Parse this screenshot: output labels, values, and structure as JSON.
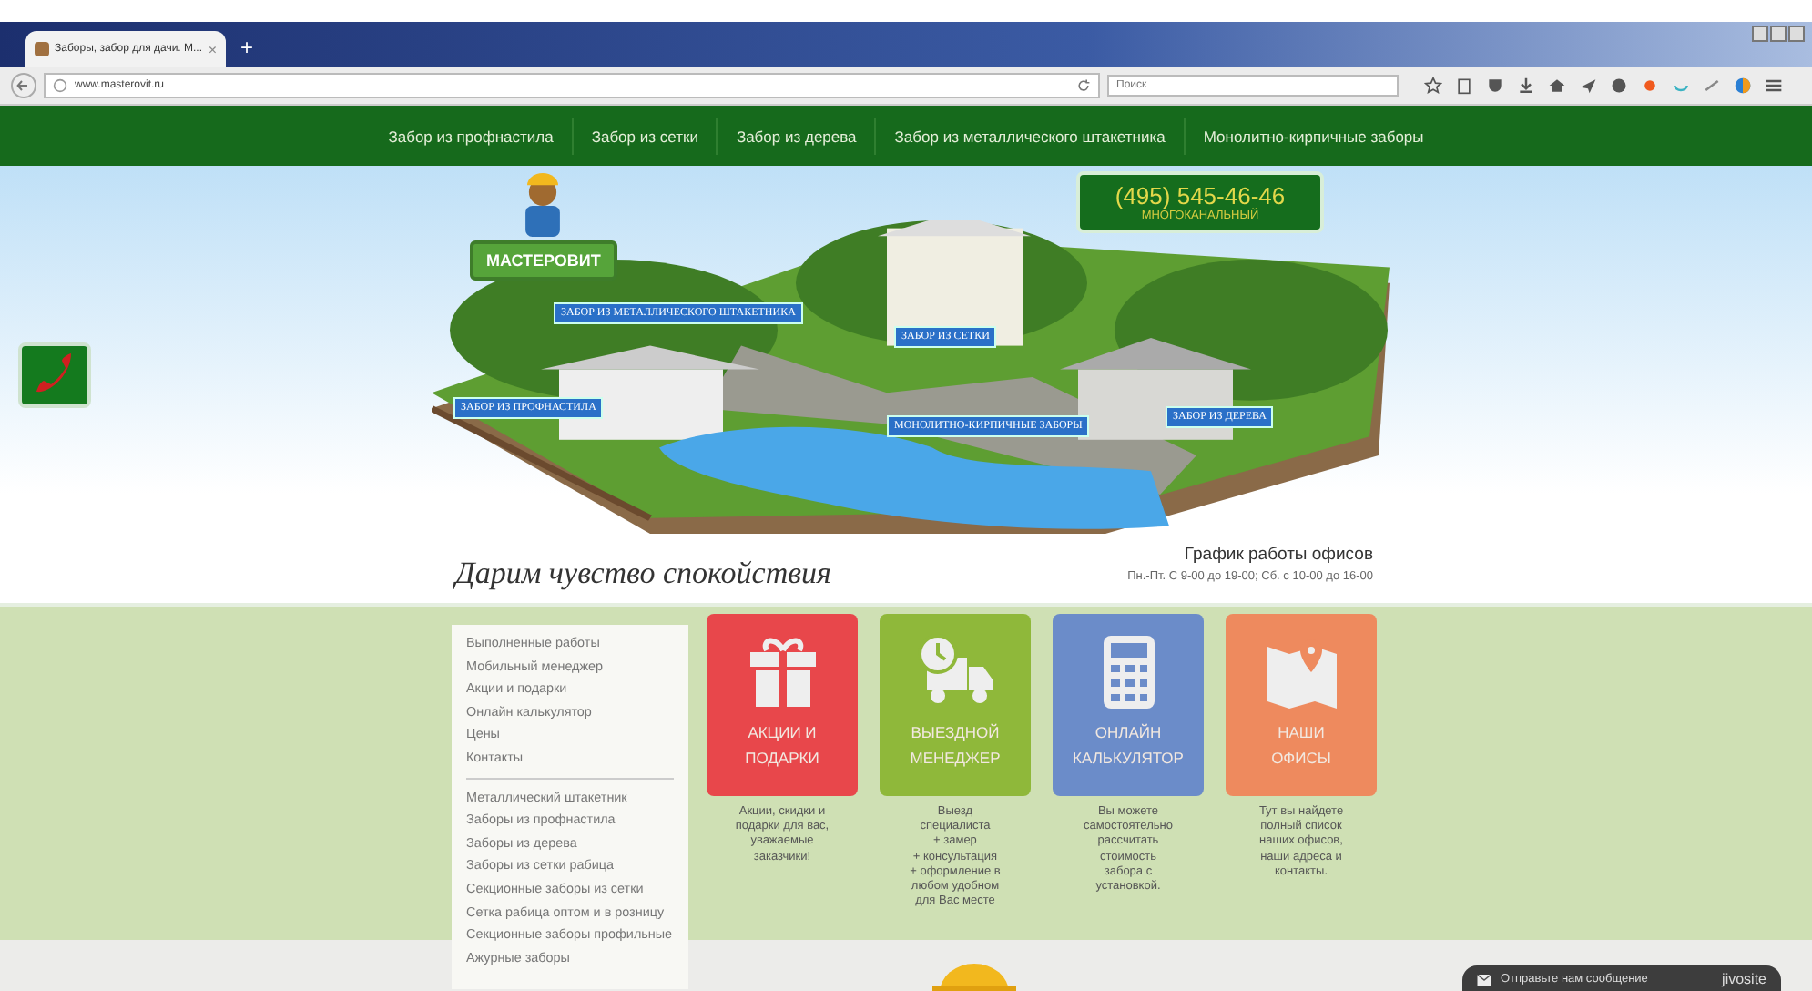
{
  "browser": {
    "tab_title": "Заборы, забор для дачи. М...",
    "tab_close": "×",
    "new_tab": "+",
    "url": "www.masterovit.ru",
    "search_placeholder": "Поиск"
  },
  "nav": [
    "Забор из профнастила",
    "Забор из сетки",
    "Забор из дерева",
    "Забор из металлического штакетника",
    "Монолитно-кирпичные заборы"
  ],
  "hero": {
    "logo": "МАСТЕРОВИТ",
    "phone": "(495) 545-46-46",
    "phone_note": "МНОГОКАНАЛЬНЫЙ",
    "map_labels": [
      "ЗАБОР ИЗ МЕТАЛЛИЧЕСКОГО ШТАКЕТНИКА",
      "ЗАБОР ИЗ ПРОФНАСТИЛА",
      "ЗАБОР ИЗ СЕТКИ",
      "МОНОЛИТНО-КИРПИЧНЫЕ ЗАБОРЫ",
      "ЗАБОР ИЗ ДЕРЕВА"
    ],
    "slogan": "Дарим чувство спокойствия",
    "schedule_title": "График работы офисов",
    "schedule": "Пн.-Пт. С 9-00 до 19-00; Сб. с 10-00 до 16-00"
  },
  "sidebar": {
    "groups": [
      [
        "Выполненные работы",
        "Мобильный менеджер",
        "Акции и подарки",
        "Онлайн калькулятор",
        "Цены",
        "Контакты"
      ],
      [
        "Металлический штакетник",
        "Заборы из профнастила",
        "Заборы из дерева",
        "Заборы из сетки рабица",
        "Секционные заборы из сетки",
        "Сетка рабица оптом и в розницу",
        "Секционные заборы профильные",
        "Ажурные заборы"
      ]
    ]
  },
  "tiles": [
    {
      "kind": "gift",
      "color": "#e8474b",
      "title": [
        "АКЦИИ И",
        "ПОДАРКИ"
      ],
      "text": [
        "Акции, скидки и",
        "подарки для вас,",
        "уважаемые",
        "заказчики!"
      ]
    },
    {
      "kind": "truck",
      "color": "#8fb83a",
      "title": [
        "ВЫЕЗДНОЙ",
        "МЕНЕДЖЕР"
      ],
      "text": [
        "Выезд",
        "специалиста",
        "+ замер",
        "+ консультация",
        "+ оформление в",
        "любом удобном",
        "для Вас месте"
      ]
    },
    {
      "kind": "calculator",
      "color": "#6b8cc9",
      "title": [
        "ОНЛАЙН",
        "КАЛЬКУЛЯТОР"
      ],
      "text": [
        "Вы можете",
        "самостоятельно",
        "рассчитать",
        "стоимость",
        "забора с",
        "установкой."
      ]
    },
    {
      "kind": "map",
      "color": "#ee8a5e",
      "title": [
        "НАШИ",
        "ОФИСЫ"
      ],
      "text": [
        "Тут вы найдете",
        "полный список",
        "наших офисов,",
        "наши адреса и",
        "контакты."
      ]
    }
  ],
  "chat": {
    "label": "Отправьте нам сообщение",
    "brand": "jivosite"
  }
}
